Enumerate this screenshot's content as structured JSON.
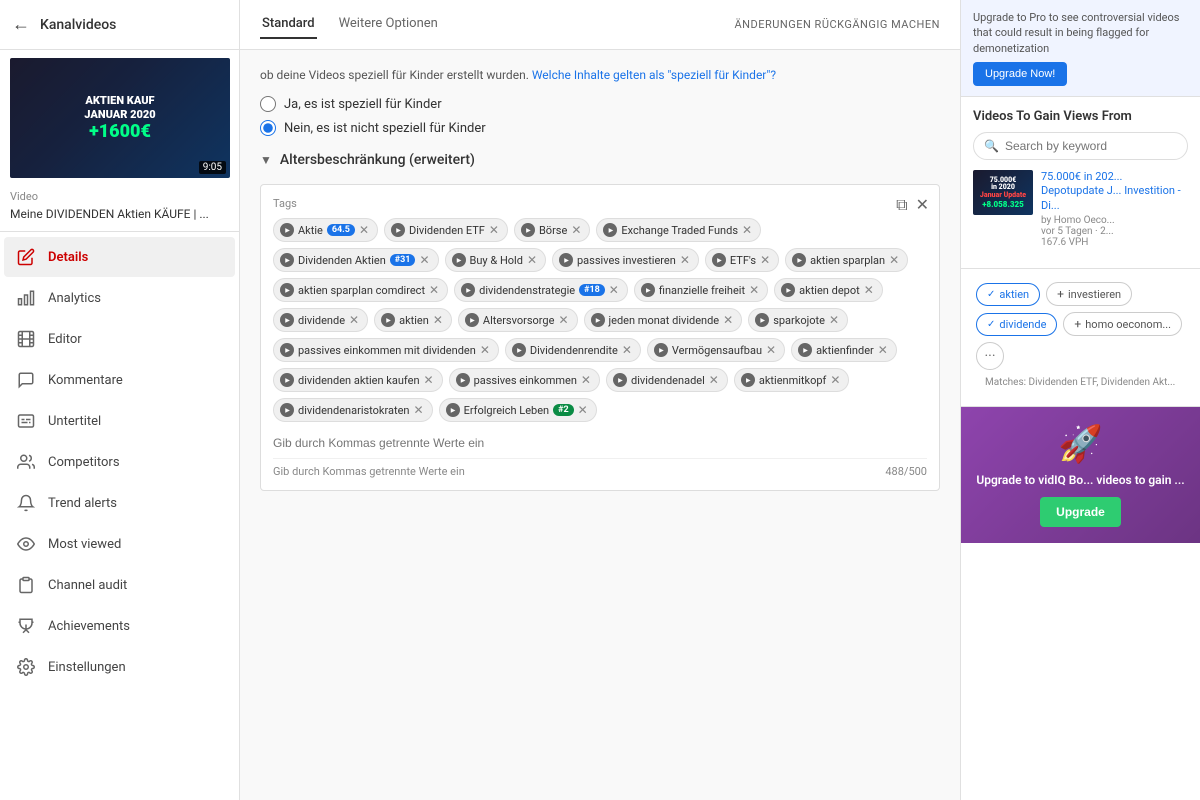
{
  "sidebar": {
    "back_label": "←",
    "title": "Kanalvideos",
    "video": {
      "duration": "9:05",
      "label": "Video",
      "name": "Meine DIVIDENDEN Aktien KÄUFE | ..."
    },
    "nav_items": [
      {
        "id": "details",
        "label": "Details",
        "active": true,
        "icon": "pencil"
      },
      {
        "id": "analytics",
        "label": "Analytics",
        "active": false,
        "icon": "bar-chart"
      },
      {
        "id": "editor",
        "label": "Editor",
        "active": false,
        "icon": "film"
      },
      {
        "id": "kommentare",
        "label": "Kommentare",
        "active": false,
        "icon": "comment"
      },
      {
        "id": "untertitel",
        "label": "Untertitel",
        "active": false,
        "icon": "subtitles"
      },
      {
        "id": "competitors",
        "label": "Competitors",
        "active": false,
        "icon": "users"
      },
      {
        "id": "trend-alerts",
        "label": "Trend alerts",
        "active": false,
        "icon": "bell"
      },
      {
        "id": "most-viewed",
        "label": "Most viewed",
        "active": false,
        "icon": "eye"
      },
      {
        "id": "channel-audit",
        "label": "Channel audit",
        "active": false,
        "icon": "clipboard"
      },
      {
        "id": "achievements",
        "label": "Achievements",
        "active": false,
        "icon": "trophy"
      },
      {
        "id": "einstellungen",
        "label": "Einstellungen",
        "active": false,
        "icon": "gear"
      }
    ]
  },
  "header": {
    "tabs": [
      {
        "label": "Standard",
        "active": true
      },
      {
        "label": "Weitere Optionen",
        "active": false
      }
    ],
    "undo_label": "ÄNDERUNGEN RÜCKGÄNGIG MACHEN"
  },
  "main": {
    "info_text": "ob deine Videos speziell für Kinder erstellt wurden.",
    "info_link": "Welche Inhalte gelten als \"speziell für Kinder\"?",
    "radio_yes": "Ja, es ist speziell für Kinder",
    "radio_no": "Nein, es ist nicht speziell für Kinder",
    "age_restriction": "Altersbeschränkung (erweitert)",
    "tags": {
      "header": "Tags",
      "items": [
        {
          "label": "Aktie",
          "badge": "64.5",
          "badge_color": "blue"
        },
        {
          "label": "Dividenden ETF",
          "badge": null
        },
        {
          "label": "Börse",
          "badge": null
        },
        {
          "label": "Exchange Traded Funds",
          "badge": null
        },
        {
          "label": "Dividenden Aktien",
          "badge": "#31",
          "badge_color": "blue"
        },
        {
          "label": "Buy & Hold",
          "badge": null
        },
        {
          "label": "passives investieren",
          "badge": null
        },
        {
          "label": "ETF's",
          "badge": null
        },
        {
          "label": "aktien sparplan",
          "badge": null
        },
        {
          "label": "aktien sparplan comdirect",
          "badge": null
        },
        {
          "label": "dividendenstrategie",
          "badge": "#18",
          "badge_color": "blue"
        },
        {
          "label": "finanzielle freiheit",
          "badge": null
        },
        {
          "label": "aktien depot",
          "badge": null
        },
        {
          "label": "dividende",
          "badge": null
        },
        {
          "label": "aktien",
          "badge": null
        },
        {
          "label": "Altersvorsorge",
          "badge": null
        },
        {
          "label": "jeden monat dividende",
          "badge": null
        },
        {
          "label": "sparkojote",
          "badge": null
        },
        {
          "label": "passives einkommen mit dividenden",
          "badge": null
        },
        {
          "label": "Dividendenrendite",
          "badge": null
        },
        {
          "label": "Vermögensaufbau",
          "badge": null
        },
        {
          "label": "aktienfinder",
          "badge": null
        },
        {
          "label": "dividenden aktien kaufen",
          "badge": null
        },
        {
          "label": "passives einkommen",
          "badge": null
        },
        {
          "label": "dividendenadel",
          "badge": null
        },
        {
          "label": "aktienmitkopf",
          "badge": null
        },
        {
          "label": "dividendenaristokraten",
          "badge": null
        },
        {
          "label": "Erfolgreich Leben",
          "badge": "#2",
          "badge_color": "blue"
        }
      ],
      "input_placeholder": "Gib durch Kommas getrennte Werte ein",
      "count": "488/500"
    }
  },
  "right_panel": {
    "upgrade_text": "Upgrade to Pro to see controversial videos that could result in being flagged for demonetization",
    "upgrade_btn": "Upgrade Now!",
    "views_title": "Videos To Gain Views From",
    "search_placeholder": "Search by keyword",
    "recommended": {
      "title": "75.000€ in 2020 Januar Update Depotupdate J... Investition - Di...",
      "by": "by Homo Oeco...",
      "days": "vor 5 Tagen · 2...",
      "vph": "167.6 VPH"
    },
    "filter_tags": [
      {
        "label": "aktien",
        "type": "checked"
      },
      {
        "label": "investieren",
        "type": "add"
      },
      {
        "label": "dividende",
        "type": "checked"
      },
      {
        "label": "homo oeconomicus",
        "type": "add"
      }
    ],
    "matches_text": "Matches: Dividenden ETF, Dividenden Akt...",
    "promo_title": "Upgrade to vidIQ Bo... videos to gain ...",
    "promo_btn": "Upgrade"
  }
}
